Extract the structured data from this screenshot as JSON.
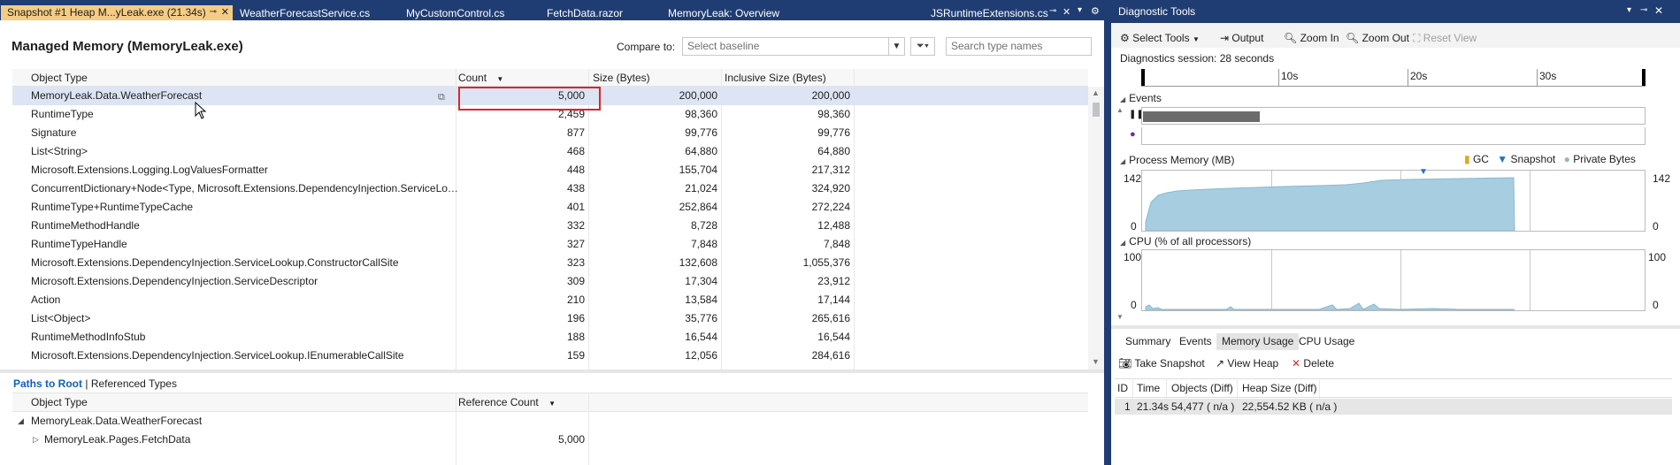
{
  "tabs": [
    {
      "label": "Snapshot #1 Heap M...yLeak.exe (21.34s)",
      "active": true
    },
    {
      "label": "WeatherForecastService.cs"
    },
    {
      "label": "MyCustomControl.cs"
    },
    {
      "label": "FetchData.razor"
    },
    {
      "label": "MemoryLeak: Overview"
    },
    {
      "label": "JSRuntimeExtensions.cs"
    }
  ],
  "managed": {
    "title": "Managed Memory (MemoryLeak.exe)",
    "compare_label": "Compare to:",
    "baseline_placeholder": "Select baseline",
    "search_placeholder": "Search type names",
    "columns": [
      "Object Type",
      "Count",
      "Size (Bytes)",
      "Inclusive Size (Bytes)"
    ],
    "rows": [
      [
        "MemoryLeak.Data.WeatherForecast",
        "5,000",
        "200,000",
        "200,000"
      ],
      [
        "RuntimeType",
        "2,459",
        "98,360",
        "98,360"
      ],
      [
        "Signature",
        "877",
        "99,776",
        "99,776"
      ],
      [
        "List<String>",
        "468",
        "64,880",
        "64,880"
      ],
      [
        "Microsoft.Extensions.Logging.LogValuesFormatter",
        "448",
        "155,704",
        "217,312"
      ],
      [
        "ConcurrentDictionary+Node<Type, Microsoft.Extensions.DependencyInjection.ServiceLo…",
        "438",
        "21,024",
        "324,920"
      ],
      [
        "RuntimeType+RuntimeTypeCache",
        "401",
        "252,864",
        "272,224"
      ],
      [
        "RuntimeMethodHandle",
        "332",
        "8,728",
        "12,488"
      ],
      [
        "RuntimeTypeHandle",
        "327",
        "7,848",
        "7,848"
      ],
      [
        "Microsoft.Extensions.DependencyInjection.ServiceLookup.ConstructorCallSite",
        "323",
        "132,608",
        "1,055,376"
      ],
      [
        "Microsoft.Extensions.DependencyInjection.ServiceDescriptor",
        "309",
        "17,304",
        "23,912"
      ],
      [
        "Action",
        "210",
        "13,584",
        "17,144"
      ],
      [
        "List<Object>",
        "196",
        "35,776",
        "265,616"
      ],
      [
        "RuntimeMethodInfoStub",
        "188",
        "16,544",
        "16,544"
      ],
      [
        "Microsoft.Extensions.DependencyInjection.ServiceLookup.IEnumerableCallSite",
        "159",
        "12,056",
        "284,616"
      ]
    ]
  },
  "paths": {
    "tab_active": "Paths to Root",
    "separator": "|",
    "tab_other": "Referenced Types",
    "columns": [
      "Object Type",
      "Reference Count"
    ],
    "rows": [
      {
        "label": "MemoryLeak.Data.WeatherForecast",
        "count": ""
      },
      {
        "label": "MemoryLeak.Pages.FetchData",
        "count": "5,000"
      }
    ]
  },
  "diag": {
    "title": "Diagnostic Tools",
    "toolbar": {
      "select_tools": "Select Tools",
      "output": "Output",
      "zoom_in": "Zoom In",
      "zoom_out": "Zoom Out",
      "reset_view": "Reset View"
    },
    "session": "Diagnostics session: 28 seconds",
    "ruler": [
      "10s",
      "20s",
      "30s"
    ],
    "events_label": "Events",
    "memory_label": "Process Memory (MB)",
    "legend": {
      "gc": "GC",
      "snapshot": "Snapshot",
      "private": "Private Bytes"
    },
    "mem_max_left": "142",
    "mem_min_left": "0",
    "mem_max_right": "142",
    "mem_min_right": "0",
    "cpu_label": "CPU (% of all processors)",
    "cpu_max_left": "100",
    "cpu_min_left": "0",
    "cpu_max_right": "100",
    "cpu_min_right": "0",
    "bottom_tabs": [
      "Summary",
      "Events",
      "Memory Usage",
      "CPU Usage"
    ],
    "mem_tools": {
      "take": "Take Snapshot",
      "view": "View Heap",
      "delete": "Delete"
    },
    "snap_columns": [
      "ID",
      "Time",
      "Objects (Diff)",
      "Heap Size (Diff)"
    ],
    "snap_row": {
      "id": "1",
      "time": "21.34s",
      "objects": "54,477",
      "objects_diff": "( n/a )",
      "heap": "22,554.52 KB",
      "heap_diff": "( n/a )"
    }
  },
  "colors": {
    "chrome": "#1f3d73",
    "active_tab": "#f5cc84",
    "selection": "#dde4f3",
    "highlight": "#d9262b",
    "memory_fill": "#9dc4d9",
    "link": "#0e5fc0"
  }
}
